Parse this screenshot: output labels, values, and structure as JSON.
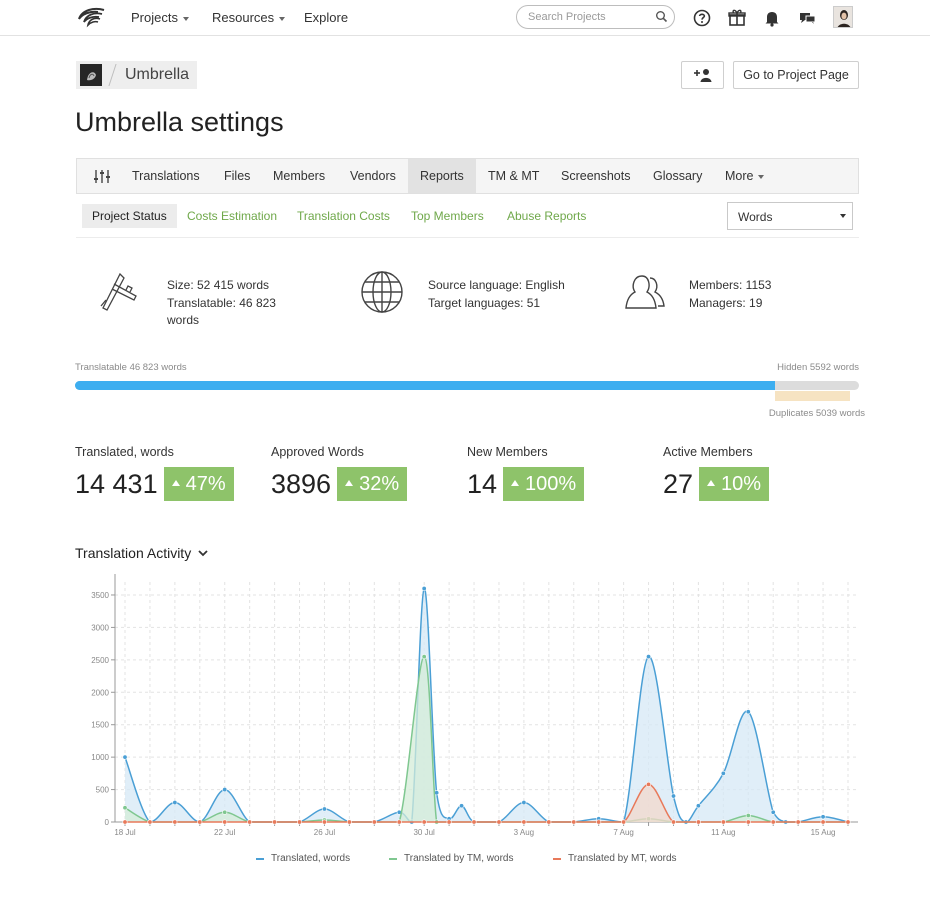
{
  "nav": {
    "projects": "Projects",
    "resources": "Resources",
    "explore": "Explore",
    "search_placeholder": "Search Projects"
  },
  "project": {
    "name": "Umbrella",
    "title": "Umbrella settings",
    "go_to_page": "Go to Project Page"
  },
  "tabs": [
    {
      "label": "Translations"
    },
    {
      "label": "Files"
    },
    {
      "label": "Members"
    },
    {
      "label": "Vendors"
    },
    {
      "label": "Reports",
      "active": true
    },
    {
      "label": "TM & MT"
    },
    {
      "label": "Screenshots"
    },
    {
      "label": "Glossary"
    },
    {
      "label": "More"
    }
  ],
  "subtabs": [
    {
      "label": "Project Status",
      "active": true
    },
    {
      "label": "Costs Estimation"
    },
    {
      "label": "Translation Costs"
    },
    {
      "label": "Top Members"
    },
    {
      "label": "Abuse Reports"
    }
  ],
  "unit_select": "Words",
  "info": {
    "size": "Size: 52 415 words",
    "translatable_1": "Translatable: 46 823",
    "translatable_2": "words",
    "source_language": "Source language: English",
    "target_languages": "Target languages: 51",
    "members": "Members: 1153",
    "managers": "Managers: 19"
  },
  "progress": {
    "translatable_label": "Translatable 46 823 words",
    "hidden_label": "Hidden 5592 words",
    "duplicates_label": "Duplicates 5039 words",
    "translatable_fraction": 0.893,
    "duplicates_start_fraction": 0.893,
    "duplicates_fraction": 0.096
  },
  "stats": [
    {
      "label": "Translated, words",
      "value": "14 431",
      "change": "47%"
    },
    {
      "label": "Approved Words",
      "value": "3896",
      "change": "32%"
    },
    {
      "label": "New Members",
      "value": "14",
      "change": "100%"
    },
    {
      "label": "Active Members",
      "value": "27",
      "change": "10%"
    }
  ],
  "chart_title": "Translation Activity",
  "chart_data": {
    "type": "area",
    "ylim": [
      0,
      3700
    ],
    "yticks": [
      0,
      500,
      1000,
      1500,
      2000,
      2500,
      3000,
      3500
    ],
    "xlim": [
      0,
      29
    ],
    "xticks": [
      {
        "x": 0,
        "label": "18 Jul"
      },
      {
        "x": 4,
        "label": "22 Jul"
      },
      {
        "x": 8,
        "label": "26 Jul"
      },
      {
        "x": 12,
        "label": "30 Jul"
      },
      {
        "x": 16,
        "label": "3 Aug"
      },
      {
        "x": 20,
        "label": "7 Aug"
      },
      {
        "x": 24,
        "label": "11 Aug"
      },
      {
        "x": 28,
        "label": "15 Aug"
      }
    ],
    "series": [
      {
        "name": "Translated, words",
        "color": "#4a9fd5",
        "fill": "#d6e8f6",
        "points": [
          [
            0,
            1000
          ],
          [
            1,
            0
          ],
          [
            2,
            300
          ],
          [
            3,
            0
          ],
          [
            4,
            500
          ],
          [
            5,
            0
          ],
          [
            6,
            0
          ],
          [
            7,
            0
          ],
          [
            8,
            200
          ],
          [
            9,
            0
          ],
          [
            10,
            0
          ],
          [
            11,
            150
          ],
          [
            11.5,
            0
          ],
          [
            12,
            3600
          ],
          [
            12.5,
            450
          ],
          [
            13,
            50
          ],
          [
            13.5,
            250
          ],
          [
            14,
            0
          ],
          [
            15,
            0
          ],
          [
            16,
            300
          ],
          [
            17,
            0
          ],
          [
            18,
            0
          ],
          [
            19,
            50
          ],
          [
            20,
            0
          ],
          [
            21,
            2550
          ],
          [
            22,
            400
          ],
          [
            22.5,
            0
          ],
          [
            23,
            250
          ],
          [
            24,
            750
          ],
          [
            25,
            1700
          ],
          [
            26,
            150
          ],
          [
            26.5,
            0
          ],
          [
            27,
            0
          ],
          [
            28,
            80
          ],
          [
            29,
            0
          ]
        ]
      },
      {
        "name": "Translated by TM, words",
        "color": "#7fc790",
        "fill": "#d4ecd8",
        "points": [
          [
            0,
            220
          ],
          [
            1,
            0
          ],
          [
            2,
            0
          ],
          [
            3,
            0
          ],
          [
            4,
            150
          ],
          [
            5,
            0
          ],
          [
            6,
            0
          ],
          [
            7,
            0
          ],
          [
            8,
            30
          ],
          [
            9,
            0
          ],
          [
            10,
            0
          ],
          [
            11,
            0
          ],
          [
            12,
            2550
          ],
          [
            12.5,
            0
          ],
          [
            13,
            0
          ],
          [
            14,
            0
          ],
          [
            15,
            0
          ],
          [
            16,
            0
          ],
          [
            17,
            0
          ],
          [
            18,
            0
          ],
          [
            19,
            0
          ],
          [
            20,
            0
          ],
          [
            21,
            50
          ],
          [
            22,
            0
          ],
          [
            23,
            0
          ],
          [
            24,
            0
          ],
          [
            25,
            100
          ],
          [
            26,
            0
          ],
          [
            27,
            0
          ],
          [
            28,
            0
          ],
          [
            29,
            0
          ]
        ]
      },
      {
        "name": "Translated by MT, words",
        "color": "#e8795a",
        "fill": "#f3d8cc",
        "points": [
          [
            0,
            0
          ],
          [
            1,
            0
          ],
          [
            2,
            0
          ],
          [
            3,
            0
          ],
          [
            4,
            0
          ],
          [
            5,
            0
          ],
          [
            6,
            0
          ],
          [
            7,
            0
          ],
          [
            8,
            0
          ],
          [
            9,
            0
          ],
          [
            10,
            0
          ],
          [
            11,
            0
          ],
          [
            12,
            0
          ],
          [
            13,
            0
          ],
          [
            14,
            0
          ],
          [
            15,
            0
          ],
          [
            16,
            0
          ],
          [
            17,
            0
          ],
          [
            18,
            0
          ],
          [
            19,
            0
          ],
          [
            20,
            0
          ],
          [
            21,
            580
          ],
          [
            22,
            0
          ],
          [
            23,
            0
          ],
          [
            24,
            0
          ],
          [
            25,
            0
          ],
          [
            26,
            0
          ],
          [
            27,
            0
          ],
          [
            28,
            0
          ],
          [
            29,
            0
          ]
        ]
      }
    ]
  }
}
